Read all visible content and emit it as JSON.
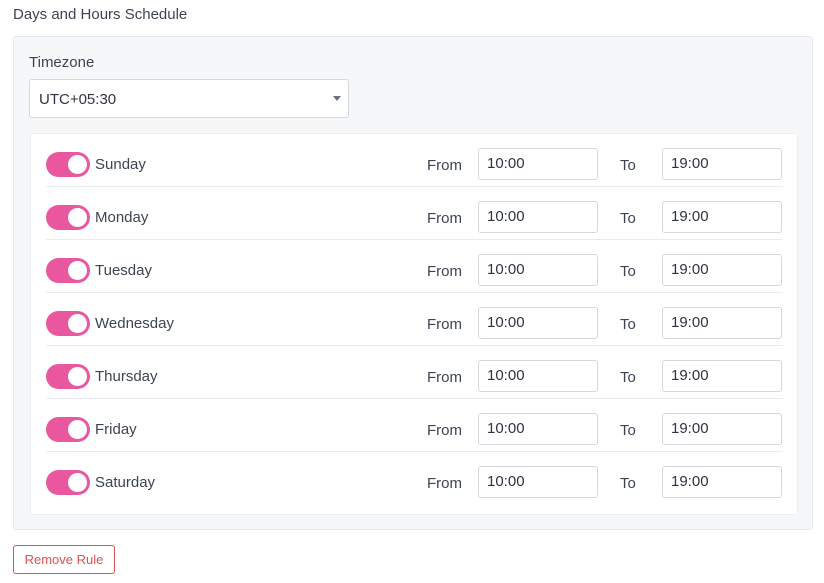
{
  "section": {
    "title": "Days and Hours Schedule"
  },
  "timezone": {
    "label": "Timezone",
    "value": "UTC+05:30",
    "icon": "chevron-down-icon"
  },
  "labels": {
    "from": "From",
    "to": "To"
  },
  "days": [
    {
      "name": "Sunday",
      "enabled": true,
      "from": "10:00",
      "to": "19:00"
    },
    {
      "name": "Monday",
      "enabled": true,
      "from": "10:00",
      "to": "19:00"
    },
    {
      "name": "Tuesday",
      "enabled": true,
      "from": "10:00",
      "to": "19:00"
    },
    {
      "name": "Wednesday",
      "enabled": true,
      "from": "10:00",
      "to": "19:00"
    },
    {
      "name": "Thursday",
      "enabled": true,
      "from": "10:00",
      "to": "19:00"
    },
    {
      "name": "Friday",
      "enabled": true,
      "from": "10:00",
      "to": "19:00"
    },
    {
      "name": "Saturday",
      "enabled": true,
      "from": "10:00",
      "to": "19:00"
    }
  ],
  "actions": {
    "remove_rule": "Remove Rule"
  },
  "colors": {
    "toggle_on": "#e9589f",
    "danger": "#e05252",
    "panel_bg": "#f6f7f9"
  }
}
